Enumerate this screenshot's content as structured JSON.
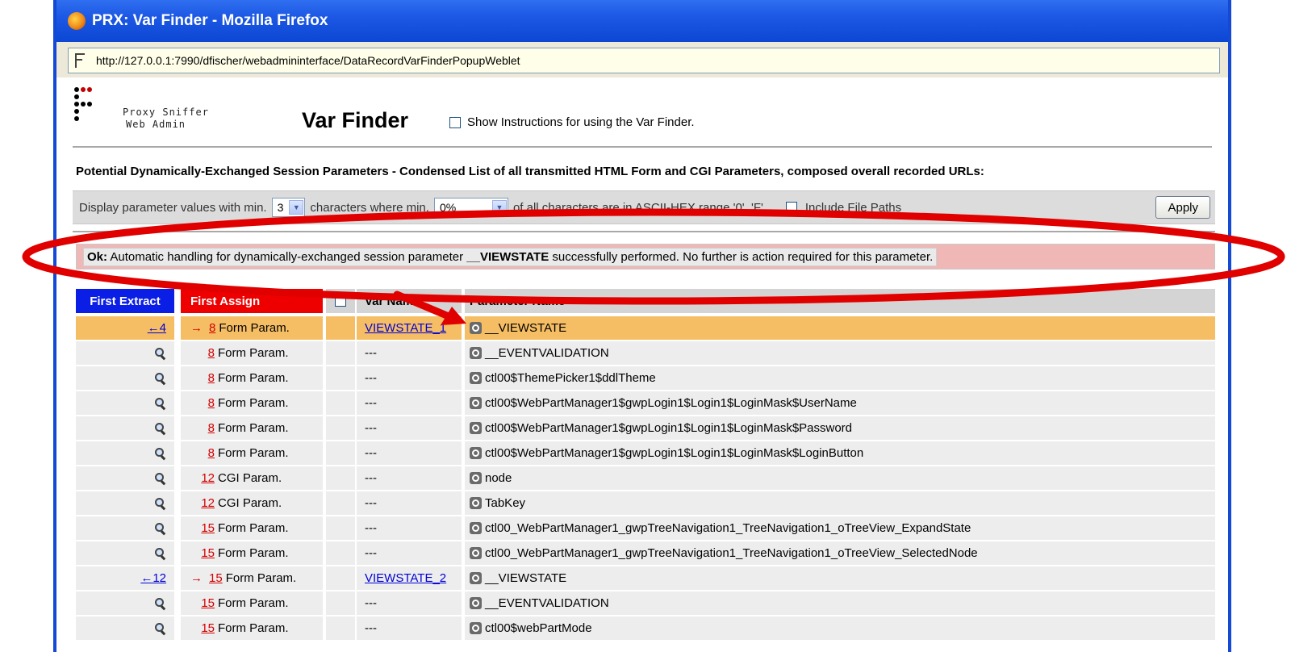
{
  "window": {
    "title": "PRX: Var Finder - Mozilla Firefox"
  },
  "address_bar": {
    "url": "http://127.0.0.1:7990/dfischer/webadmininterface/DataRecordVarFinderPopupWeblet"
  },
  "header": {
    "brand_line1": "Proxy Sniffer",
    "brand_line2": "Web Admin",
    "title": "Var Finder",
    "instructions_label": "Show Instructions for using the Var Finder."
  },
  "heading": "Potential Dynamically-Exchanged Session Parameters - Condensed List of all transmitted HTML Form and CGI Parameters, composed overall recorded URLs:",
  "filter": {
    "prefix": "Display parameter values with min.",
    "min_chars": "3",
    "mid": "characters where min.",
    "hex_pct": "0%",
    "suffix": "of all characters are in ASCII-HEX range '0'..'F'",
    "include_paths_label": "Include File Paths",
    "apply_label": "Apply"
  },
  "ok_message": {
    "prefix": "Ok:",
    "text1": "Automatic handling for dynamically-exchanged session parameter",
    "param": "__VIEWSTATE",
    "text2": "successfully performed. No further is action required for this parameter."
  },
  "table": {
    "headers": {
      "first_extract": "First Extract",
      "first_assign": "First Assign",
      "var_name": "Var Name",
      "param_name": "Parameter Name"
    },
    "rows": [
      {
        "extract": "←4",
        "assign_arrow": "→",
        "assign_num": "8",
        "type": "Form Param.",
        "var": "VIEWSTATE_1",
        "param": "__VIEWSTATE",
        "highlight": true
      },
      {
        "extract": "",
        "assign_arrow": "",
        "assign_num": "8",
        "type": "Form Param.",
        "var": "---",
        "param": "__EVENTVALIDATION",
        "highlight": false
      },
      {
        "extract": "",
        "assign_arrow": "",
        "assign_num": "8",
        "type": "Form Param.",
        "var": "---",
        "param": "ctl00$ThemePicker1$ddlTheme",
        "highlight": false
      },
      {
        "extract": "",
        "assign_arrow": "",
        "assign_num": "8",
        "type": "Form Param.",
        "var": "---",
        "param": "ctl00$WebPartManager1$gwpLogin1$Login1$LoginMask$UserName",
        "highlight": false
      },
      {
        "extract": "",
        "assign_arrow": "",
        "assign_num": "8",
        "type": "Form Param.",
        "var": "---",
        "param": "ctl00$WebPartManager1$gwpLogin1$Login1$LoginMask$Password",
        "highlight": false
      },
      {
        "extract": "",
        "assign_arrow": "",
        "assign_num": "8",
        "type": "Form Param.",
        "var": "---",
        "param": "ctl00$WebPartManager1$gwpLogin1$Login1$LoginMask$LoginButton",
        "highlight": false
      },
      {
        "extract": "",
        "assign_arrow": "",
        "assign_num": "12",
        "type": "CGI Param.",
        "var": "---",
        "param": "node",
        "highlight": false
      },
      {
        "extract": "",
        "assign_arrow": "",
        "assign_num": "12",
        "type": "CGI Param.",
        "var": "---",
        "param": "TabKey",
        "highlight": false
      },
      {
        "extract": "",
        "assign_arrow": "",
        "assign_num": "15",
        "type": "Form Param.",
        "var": "---",
        "param": "ctl00_WebPartManager1_gwpTreeNavigation1_TreeNavigation1_oTreeView_ExpandState",
        "highlight": false
      },
      {
        "extract": "",
        "assign_arrow": "",
        "assign_num": "15",
        "type": "Form Param.",
        "var": "---",
        "param": "ctl00_WebPartManager1_gwpTreeNavigation1_TreeNavigation1_oTreeView_SelectedNode",
        "highlight": false
      },
      {
        "extract": "←12",
        "assign_arrow": "→",
        "assign_num": "15",
        "type": "Form Param.",
        "var": "VIEWSTATE_2",
        "param": "__VIEWSTATE",
        "highlight": false
      },
      {
        "extract": "",
        "assign_arrow": "",
        "assign_num": "15",
        "type": "Form Param.",
        "var": "---",
        "param": "__EVENTVALIDATION",
        "highlight": false
      },
      {
        "extract": "",
        "assign_arrow": "",
        "assign_num": "15",
        "type": "Form Param.",
        "var": "---",
        "param": "ctl00$webPartMode",
        "highlight": false
      }
    ]
  },
  "colors": {
    "titlebar": "#0b47d3",
    "extract_header": "#0a1ee6",
    "assign_header": "#ee0000",
    "highlight_row": "#f6be64",
    "annotation": "#e00000"
  }
}
